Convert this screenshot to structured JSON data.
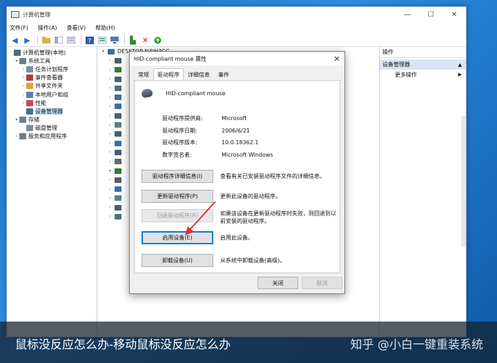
{
  "window": {
    "title": "计算机管理",
    "controls": {
      "minimize": "—",
      "maximize": "☐",
      "close": "✕"
    }
  },
  "menu": [
    "文件(F)",
    "操作(A)",
    "查看(V)",
    "帮助(H)"
  ],
  "tree": {
    "items": [
      {
        "label": "计算机管理(本地)",
        "level": 0,
        "arrow": "",
        "color": "#4a6b8a"
      },
      {
        "label": "系统工具",
        "level": 1,
        "arrow": "▾",
        "color": "#6b7d8f"
      },
      {
        "label": "任务计划程序",
        "level": 2,
        "arrow": "›",
        "color": "#7a8fa3"
      },
      {
        "label": "事件查看器",
        "level": 2,
        "arrow": "›",
        "color": "#b0403a"
      },
      {
        "label": "共享文件夹",
        "level": 2,
        "arrow": "›",
        "color": "#d8a93b"
      },
      {
        "label": "本地用户和组",
        "level": 2,
        "arrow": "›",
        "color": "#5a7fb3"
      },
      {
        "label": "性能",
        "level": 2,
        "arrow": "›",
        "color": "#c0504d"
      },
      {
        "label": "设备管理器",
        "level": 2,
        "arrow": "",
        "color": "#4a6b8a",
        "selected": true
      },
      {
        "label": "存储",
        "level": 1,
        "arrow": "▾",
        "color": "#6b7d8f"
      },
      {
        "label": "磁盘管理",
        "level": 2,
        "arrow": "",
        "color": "#7a8a9a"
      },
      {
        "label": "服务和应用程序",
        "level": 1,
        "arrow": "›",
        "color": "#6b7d8f"
      }
    ]
  },
  "middle": {
    "computer_name": "DESKTOP-N4IH3CG",
    "rows": 18
  },
  "actions": {
    "header": "操作",
    "section": "设备管理器",
    "section_arrow": "▲",
    "more": "更多操作",
    "more_arrow": "▶"
  },
  "dialog": {
    "title": "HID-compliant mouse 属性",
    "close": "✕",
    "tabs": [
      "常规",
      "驱动程序",
      "详细信息",
      "事件"
    ],
    "active_tab": 1,
    "device_name": "HID-compliant mouse",
    "props": [
      {
        "key": "驱动程序提供商:",
        "value": "Microsoft"
      },
      {
        "key": "驱动程序日期:",
        "value": "2006/6/21"
      },
      {
        "key": "驱动程序版本:",
        "value": "10.0.18362.1"
      },
      {
        "key": "数字签名者:",
        "value": "Microsoft Windows"
      }
    ],
    "buttons": [
      {
        "label": "驱动程序详细信息(I)",
        "desc": "查看有关已安装驱动程序文件的详细信息。",
        "disabled": false
      },
      {
        "label": "更新驱动程序(P)",
        "desc": "更新此设备的驱动程序。",
        "disabled": false
      },
      {
        "label": "回退驱动程序(R)",
        "desc": "如果该设备在更新驱动程序时失败，则回退到以前安装的驱动程序。",
        "disabled": true
      },
      {
        "label": "启用设备(E)",
        "desc": "启用此设备。",
        "disabled": false,
        "focused": true
      },
      {
        "label": "卸载设备(U)",
        "desc": "从系统中卸载设备(高级)。",
        "disabled": false
      }
    ],
    "ok": "关闭",
    "cancel": "取消",
    "annotation_color": "#e03030"
  },
  "caption": {
    "left": "鼠标没反应怎么办-移动鼠标没反应怎么办",
    "right": "知乎 @小白一键重装系统"
  }
}
